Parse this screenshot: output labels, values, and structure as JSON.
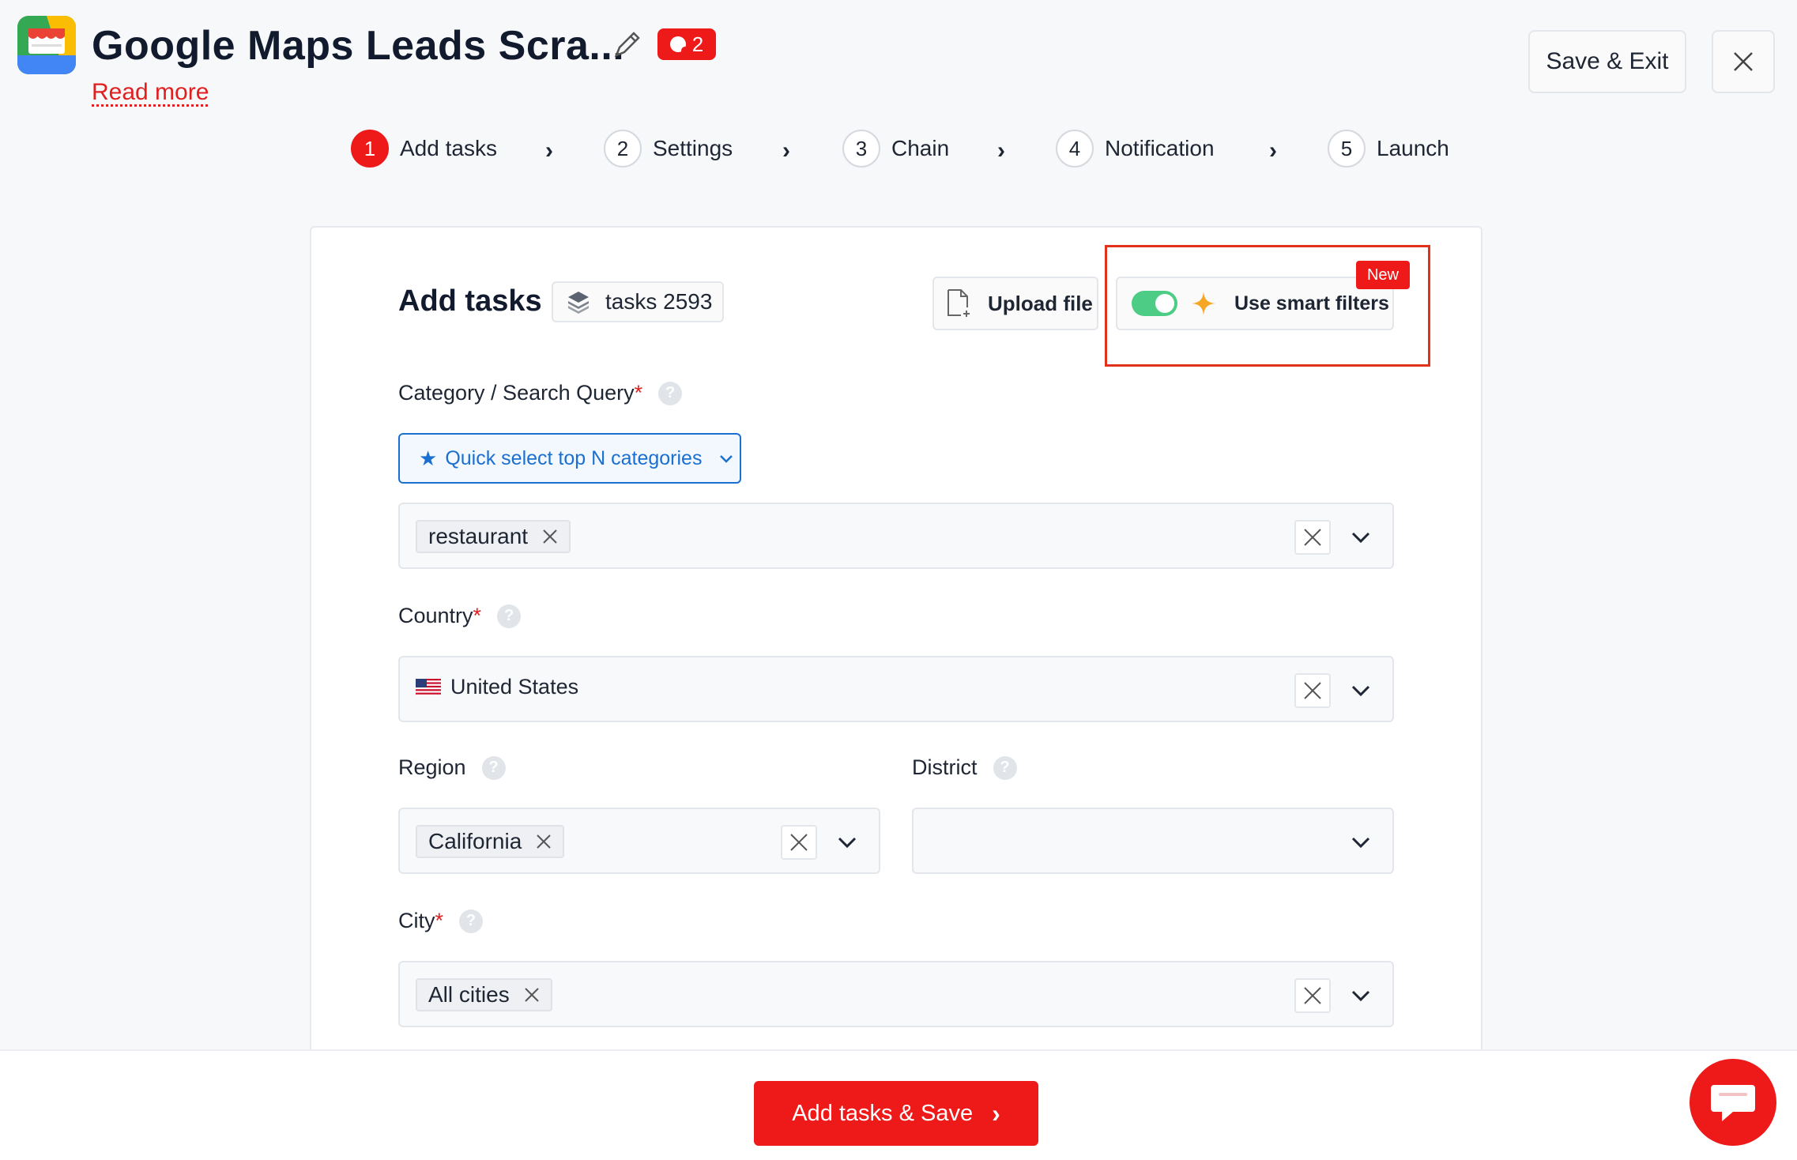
{
  "header": {
    "title": "Google Maps Leads Scra...",
    "read_more": "Read more",
    "badge_count": "2",
    "save_exit_label": "Save & Exit"
  },
  "stepper": [
    {
      "num": "1",
      "label": "Add tasks",
      "active": true
    },
    {
      "num": "2",
      "label": "Settings",
      "active": false
    },
    {
      "num": "3",
      "label": "Chain",
      "active": false
    },
    {
      "num": "4",
      "label": "Notification",
      "active": false
    },
    {
      "num": "5",
      "label": "Launch",
      "active": false
    }
  ],
  "add_tasks": {
    "title": "Add tasks",
    "tasks_pill": "tasks 2593",
    "upload_label": "Upload file",
    "smart_filters_label": "Use smart filters",
    "smart_filters_on": true,
    "new_badge": "New"
  },
  "fields": {
    "category": {
      "label": "Category / Search Query",
      "required": "*",
      "quick_select": "Quick select top N categories",
      "chips": [
        "restaurant"
      ]
    },
    "country": {
      "label": "Country",
      "required": "*",
      "value": "United States"
    },
    "region": {
      "label": "Region",
      "chips": [
        "California"
      ]
    },
    "district": {
      "label": "District",
      "value": ""
    },
    "city": {
      "label": "City",
      "required": "*",
      "chips": [
        "All cities"
      ]
    }
  },
  "footer": {
    "primary_label": "Add tasks & Save"
  },
  "colors": {
    "accent_red": "#ee1a1a",
    "link_blue": "#1a6fd0",
    "toggle_green": "#4ccc85",
    "star_orange": "#f5a623"
  },
  "icons": [
    "app-logo-icon",
    "pencil-icon",
    "record-icon",
    "close-icon",
    "chevron-right-icon",
    "layers-icon",
    "file-upload-icon",
    "sparkle-icon",
    "help-icon",
    "star-icon",
    "chevron-down-icon",
    "us-flag-icon",
    "chat-icon"
  ]
}
